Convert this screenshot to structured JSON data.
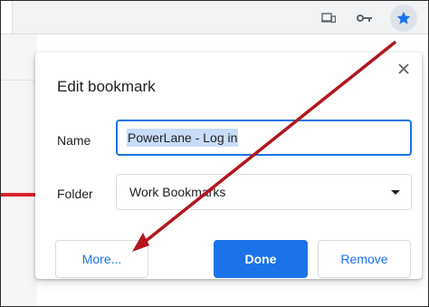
{
  "toolbar": {
    "icons": [
      "cast-icon",
      "key-icon",
      "star-icon"
    ],
    "star_color": "#1a73e8"
  },
  "dialog": {
    "title": "Edit bookmark",
    "close_symbol": "×",
    "name_label": "Name",
    "name_value": "PowerLane - Log in",
    "folder_label": "Folder",
    "folder_value": "Work Bookmarks",
    "buttons": {
      "more": "More...",
      "done": "Done",
      "remove": "Remove"
    }
  },
  "colors": {
    "accent": "#1a73e8",
    "annotation_arrow": "#b3161c",
    "page_stripe": "#d8232a"
  }
}
